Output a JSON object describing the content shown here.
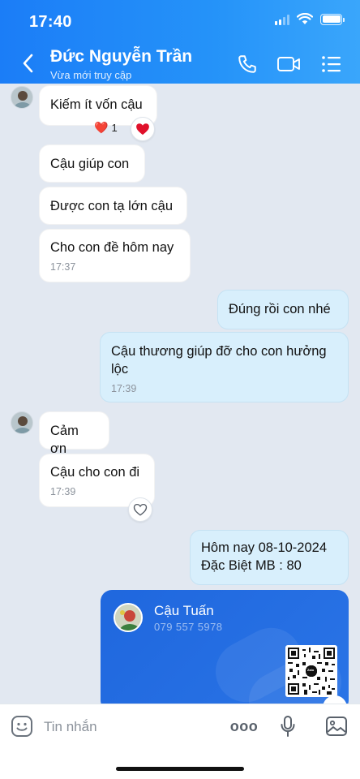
{
  "status_bar": {
    "time": "17:40"
  },
  "header": {
    "contact_name": "Đức Nguyễn Trần",
    "contact_status": "Vừa mới truy cập",
    "back_icon": "chevron-left-icon",
    "call_icon": "phone-icon",
    "video_icon": "video-camera-icon",
    "menu_icon": "list-menu-icon"
  },
  "messages": [
    {
      "direction": "in",
      "text": "Kiếm ít vốn cậu",
      "reaction_emoji": "❤️",
      "reaction_count": "1"
    },
    {
      "direction": "in",
      "text": "Cậu giúp con"
    },
    {
      "direction": "in",
      "text": "Được con tạ lớn cậu"
    },
    {
      "direction": "in",
      "text": "Cho con đề hôm nay",
      "time": "17:37"
    },
    {
      "direction": "out",
      "text": "Đúng rồi con nhé"
    },
    {
      "direction": "out",
      "text": "Cậu thương giúp đỡ cho con hưởng lộc",
      "time": "17:39"
    },
    {
      "direction": "in",
      "text": "Cảm ơn"
    },
    {
      "direction": "in",
      "text": "Cậu cho con đi",
      "time": "17:39"
    },
    {
      "direction": "out",
      "text_line1": "Hôm nay 08-10-2024",
      "text_line2": "Đặc Biệt MB : 80"
    }
  ],
  "contact_card": {
    "name": "Cậu Tuấn",
    "phone": "079 557 5978",
    "qr_badge": "Zalo"
  },
  "input_bar": {
    "placeholder": "Tin nhắn",
    "more_label": "ooo"
  },
  "colors": {
    "header_blue": "#1b7df7",
    "outgoing_bubble": "#d8effc",
    "incoming_bubble": "#ffffff",
    "card_blue": "#1f67de",
    "heart_red": "#e0112b"
  }
}
